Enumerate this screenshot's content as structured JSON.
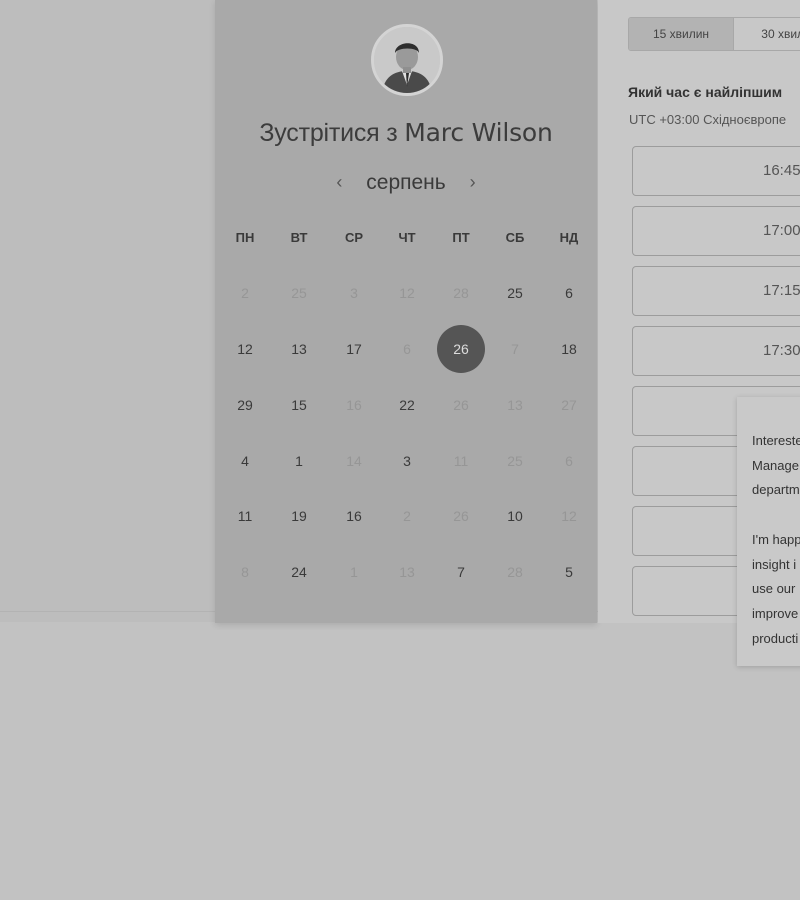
{
  "header": {
    "title_prefix": "Зустрітися з",
    "host_name": "Marc Wilson"
  },
  "calendar": {
    "month": "серпень",
    "prev_icon": "chevron-left-icon",
    "next_icon": "chevron-right-icon",
    "weekdays": [
      "ПН",
      "ВТ",
      "СР",
      "ЧТ",
      "ПТ",
      "СБ",
      "НД"
    ],
    "weeks": [
      [
        {
          "d": "2",
          "m": true
        },
        {
          "d": "25",
          "m": true
        },
        {
          "d": "3",
          "m": true
        },
        {
          "d": "12",
          "m": true
        },
        {
          "d": "28",
          "m": true
        },
        {
          "d": "25",
          "m": false
        },
        {
          "d": "6",
          "m": false
        }
      ],
      [
        {
          "d": "12",
          "m": false
        },
        {
          "d": "13",
          "m": false
        },
        {
          "d": "17",
          "m": false
        },
        {
          "d": "6",
          "m": true
        },
        {
          "d": "26",
          "m": false,
          "selected": true
        },
        {
          "d": "7",
          "m": true
        },
        {
          "d": "18",
          "m": false
        }
      ],
      [
        {
          "d": "29",
          "m": false
        },
        {
          "d": "15",
          "m": false
        },
        {
          "d": "16",
          "m": true
        },
        {
          "d": "22",
          "m": false
        },
        {
          "d": "26",
          "m": true
        },
        {
          "d": "13",
          "m": true
        },
        {
          "d": "27",
          "m": true
        }
      ],
      [
        {
          "d": "4",
          "m": false
        },
        {
          "d": "1",
          "m": false
        },
        {
          "d": "14",
          "m": true
        },
        {
          "d": "3",
          "m": false
        },
        {
          "d": "11",
          "m": true
        },
        {
          "d": "25",
          "m": true
        },
        {
          "d": "6",
          "m": true
        }
      ],
      [
        {
          "d": "11",
          "m": false
        },
        {
          "d": "19",
          "m": false
        },
        {
          "d": "16",
          "m": false
        },
        {
          "d": "2",
          "m": true
        },
        {
          "d": "26",
          "m": true
        },
        {
          "d": "10",
          "m": false
        },
        {
          "d": "12",
          "m": true
        }
      ],
      [
        {
          "d": "8",
          "m": true
        },
        {
          "d": "24",
          "m": false
        },
        {
          "d": "1",
          "m": true
        },
        {
          "d": "13",
          "m": true
        },
        {
          "d": "7",
          "m": false
        },
        {
          "d": "28",
          "m": true
        },
        {
          "d": "5",
          "m": false
        }
      ]
    ]
  },
  "durations": [
    {
      "label": "15 хвилин",
      "active": true
    },
    {
      "label": "30 хвили",
      "active": false
    }
  ],
  "question": "Який час є найліпшим",
  "timezone": "UTC +03:00 Східноєвропе",
  "slots": [
    "16:45",
    "17:00",
    "17:15",
    "17:30",
    "",
    "",
    "",
    ""
  ],
  "overlay": {
    "lines_1": [
      "Intereste",
      "Manage",
      "departm"
    ],
    "lines_2": [
      "I'm happ",
      "insight i",
      "use our",
      "improve",
      "producti"
    ]
  }
}
